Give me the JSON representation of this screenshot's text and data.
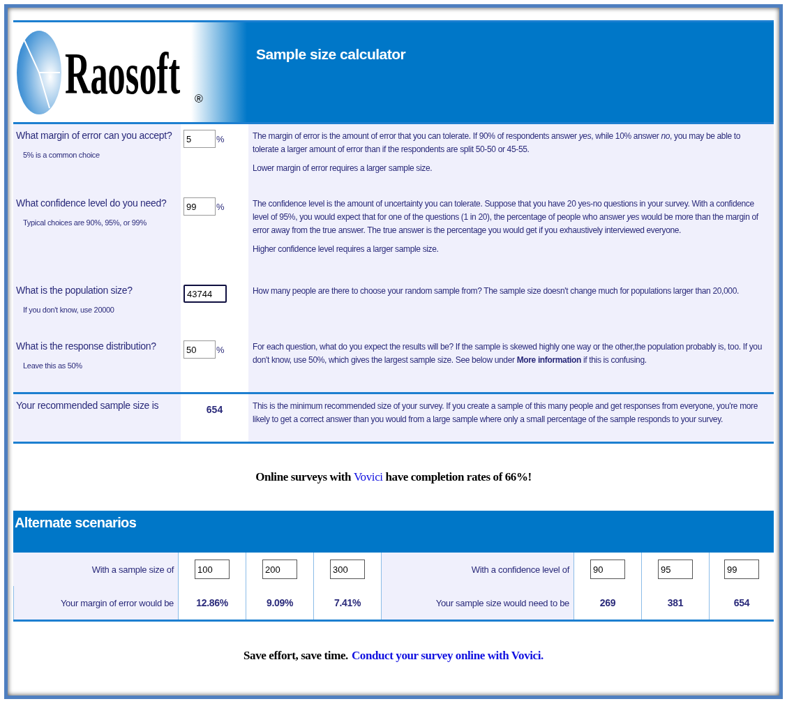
{
  "header": {
    "logo": {
      "name": "Raosoft",
      "mark": "®"
    },
    "title": "Sample size calculator"
  },
  "questions": [
    {
      "label": "What margin of error can you accept?",
      "hint": "5% is a common choice",
      "value": "5",
      "unit": "%",
      "focused": false,
      "notes": [
        "The margin of error is the amount of error that you can tolerate. If 90% of respondents answer *yes*, while 10% answer *no*, you may be able to tolerate a larger amount of error than if the respondents are split 50-50 or 45-55.",
        "Lower margin of error requires a larger sample size."
      ]
    },
    {
      "label": "What confidence level do you need?",
      "hint": "Typical choices are 90%, 95%, or 99%",
      "value": "99",
      "unit": "%",
      "focused": false,
      "notes": [
        "The confidence level is the amount of uncertainty you can tolerate. Suppose that you have 20 yes-no questions in your survey. With a confidence level of 95%, you would expect that for one of the questions (1 in 20), the percentage of people who answer *yes* would be more than the margin of error away from the true answer. The true answer is the percentage you would get if you exhaustively interviewed everyone.",
        "Higher confidence level requires a larger sample size."
      ]
    },
    {
      "label": "What is the population size?",
      "hint": "If you don't know, use 20000",
      "value": "43744",
      "focused": true,
      "notes": [
        "How many people are there to choose your random sample from? The sample size doesn't change much for populations larger than 20,000."
      ]
    },
    {
      "label": "What is the response distribution?",
      "hint": "Leave this as 50%",
      "value": "50",
      "unit": "%",
      "focused": false,
      "notes": [
        "For each question, what do you expect the results will be? If the sample is skewed highly one way or the other,the population probably is, too. If you don't know, use 50%, which gives the largest sample size. See below under **More information** if this is confusing."
      ]
    }
  ],
  "result": {
    "label": "Your recommended sample size is",
    "value": "654",
    "note": "This is the minimum recommended size of your survey. If you create a sample of this many people and get responses from everyone, you're more likely to get a correct answer than you would from a large sample where only a small percentage of the sample responds to your survey."
  },
  "promo": {
    "before": "Online surveys with",
    "link": "Vovici",
    "after": "have completion rates of 66%!"
  },
  "alternate": {
    "title": "Alternate scenarios",
    "groups": [
      {
        "input_label": "With a sample size of",
        "inputs": [
          "100",
          "200",
          "300"
        ],
        "output_label": "Your margin of error would be",
        "outputs": [
          "12.86%",
          "9.09%",
          "7.41%"
        ]
      },
      {
        "input_label": "With a confidence level of",
        "inputs": [
          "90",
          "95",
          "99"
        ],
        "output_label": "Your sample size would need to be",
        "outputs": [
          "269",
          "381",
          "654"
        ]
      }
    ]
  },
  "footer": {
    "text": "Save effort, save time.",
    "link": "Conduct your survey online with Vovici."
  }
}
